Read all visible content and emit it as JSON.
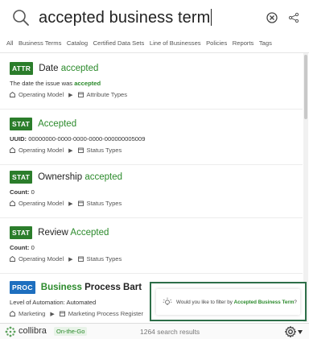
{
  "search": {
    "query": "accepted business term"
  },
  "filters": [
    "All",
    "Business Terms",
    "Catalog",
    "Certified Data Sets",
    "Line of Businesses",
    "Policies",
    "Reports",
    "Tags"
  ],
  "results": [
    {
      "badge": "ATTR",
      "title_plain": "Date ",
      "title_hl": "accepted",
      "desc_plain": "The date the issue was ",
      "desc_hl": "accepted",
      "crumb_domain": "Operating Model",
      "crumb_type": "Attribute Types"
    },
    {
      "badge": "STAT",
      "title_hl": "Accepted",
      "desc_key": "UUID:",
      "desc_value": " 00000000-0000-0000-0000-000000005009",
      "crumb_domain": "Operating Model",
      "crumb_type": "Status Types"
    },
    {
      "badge": "STAT",
      "title_plain": "Ownership ",
      "title_hl": "accepted",
      "desc_key": "Count:",
      "desc_value": " 0",
      "crumb_domain": "Operating Model",
      "crumb_type": "Status Types"
    },
    {
      "badge": "STAT",
      "title_plain": "Review ",
      "title_hl": "Accepted",
      "desc_key": "Count:",
      "desc_value": " 0",
      "crumb_domain": "Operating Model",
      "crumb_type": "Status Types"
    },
    {
      "badge": "PROC",
      "title_hl": "Business",
      "title_plain": " Process Bart",
      "desc_plain": "Level of Automation: Automated",
      "crumb_domain": "Marketing",
      "crumb_type": "Marketing Process Register"
    }
  ],
  "popup": {
    "prefix": "Would you like to filter by ",
    "highlight": "Accepted Business Term",
    "suffix": "?"
  },
  "footer": {
    "brand": "collibra",
    "tag": "On-the-Go",
    "count": "1264 search results"
  },
  "colors": {
    "highlight": "#2b8a2b",
    "badge_green": "#2b7d2b",
    "badge_blue": "#1e6fbf",
    "popup_border": "#2d6e48"
  }
}
